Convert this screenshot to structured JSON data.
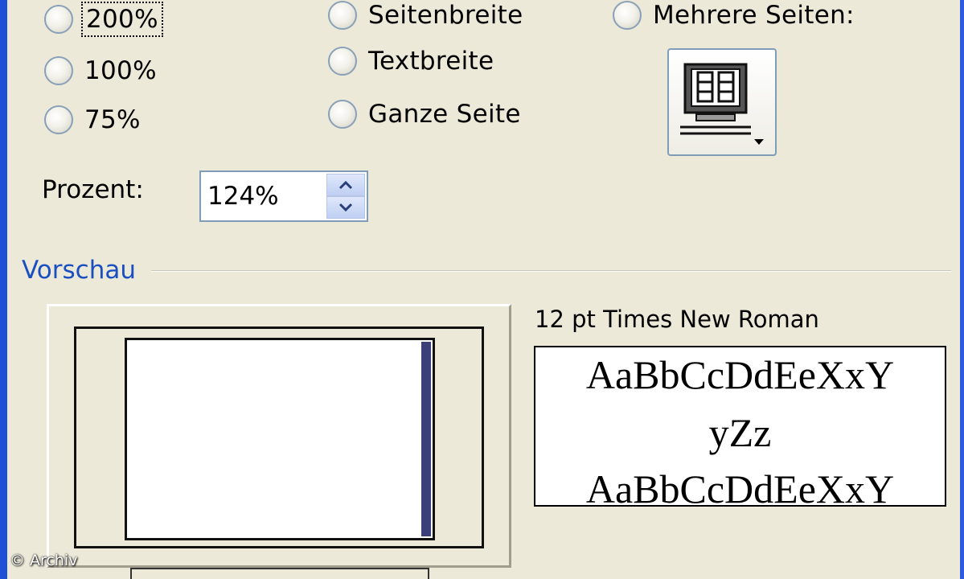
{
  "zoom_options": {
    "col1": [
      {
        "label": "200%",
        "selected": false,
        "focused": true
      },
      {
        "label": "100%",
        "selected": false
      },
      {
        "label": "75%",
        "selected": false
      }
    ],
    "col2": [
      {
        "label": "Seitenbreite",
        "selected": false
      },
      {
        "label": "Textbreite",
        "selected": false
      },
      {
        "label": "Ganze Seite",
        "selected": false
      }
    ],
    "col3": [
      {
        "label": "Mehrere Seiten:",
        "selected": false
      }
    ]
  },
  "multi_page_button": {
    "icon": "multi-page-monitor-icon"
  },
  "percent": {
    "label": "Prozent:",
    "value": "124%"
  },
  "preview": {
    "title": "Vorschau",
    "font_label": "12 pt Times New Roman",
    "sample_lines": [
      "AaBbCcDdEeXxY",
      "yZz",
      "AaBbCcDdEeXxY"
    ]
  },
  "watermark": "© Archiv",
  "colors": {
    "frame": "#1d4fd7",
    "dialog_bg": "#ece9d8",
    "group_title": "#1a4fc2",
    "border": "#7f9db9"
  }
}
